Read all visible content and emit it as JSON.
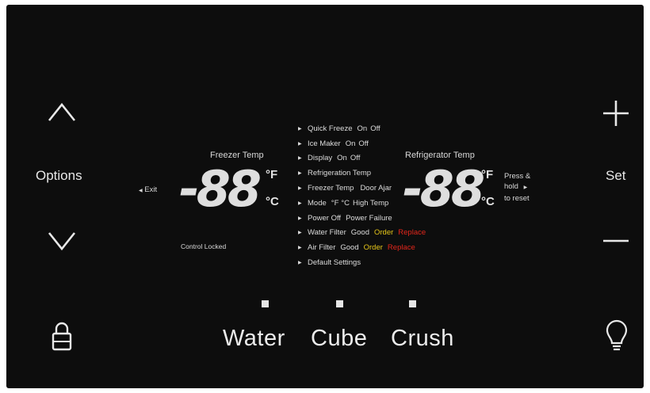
{
  "left_controls": {
    "options_label": "Options"
  },
  "right_controls": {
    "set_label": "Set"
  },
  "freezer": {
    "label": "Freezer Temp",
    "digits": "-88",
    "unit_f": "°F",
    "unit_c": "°C"
  },
  "refrigerator": {
    "label": "Refrigerator Temp",
    "digits": "-88",
    "unit_f": "°F",
    "unit_c": "°C"
  },
  "exit_label": "Exit",
  "control_locked_label": "Control Locked",
  "reset_hint": [
    "Press &",
    "hold",
    "to reset"
  ],
  "menu": {
    "quick_freeze": {
      "label": "Quick Freeze",
      "on": "On",
      "off": "Off"
    },
    "ice_maker": {
      "label": "Ice Maker",
      "on": "On",
      "off": "Off"
    },
    "display": {
      "label": "Display",
      "on": "On",
      "off": "Off"
    },
    "refrigeration_temp": {
      "label": "Refrigeration Temp"
    },
    "freezer_temp": {
      "label": "Freezer Temp",
      "extra": "Door Ajar"
    },
    "mode": {
      "label": "Mode",
      "f": "°F",
      "c": "°C",
      "extra": "High Temp"
    },
    "power_off": {
      "label": "Power Off",
      "extra": "Power Failure"
    },
    "water_filter": {
      "label": "Water Filter",
      "good": "Good",
      "order": "Order",
      "replace": "Replace"
    },
    "air_filter": {
      "label": "Air Filter",
      "good": "Good",
      "order": "Order",
      "replace": "Replace"
    },
    "default_settings": {
      "label": "Default Settings"
    }
  },
  "dispense": {
    "water": "Water",
    "cube": "Cube",
    "crush": "Crush"
  },
  "colors": {
    "panel": "#0d0d0d",
    "text": "#e9e9e9",
    "order": "#e6c619",
    "replace": "#e2261b"
  }
}
